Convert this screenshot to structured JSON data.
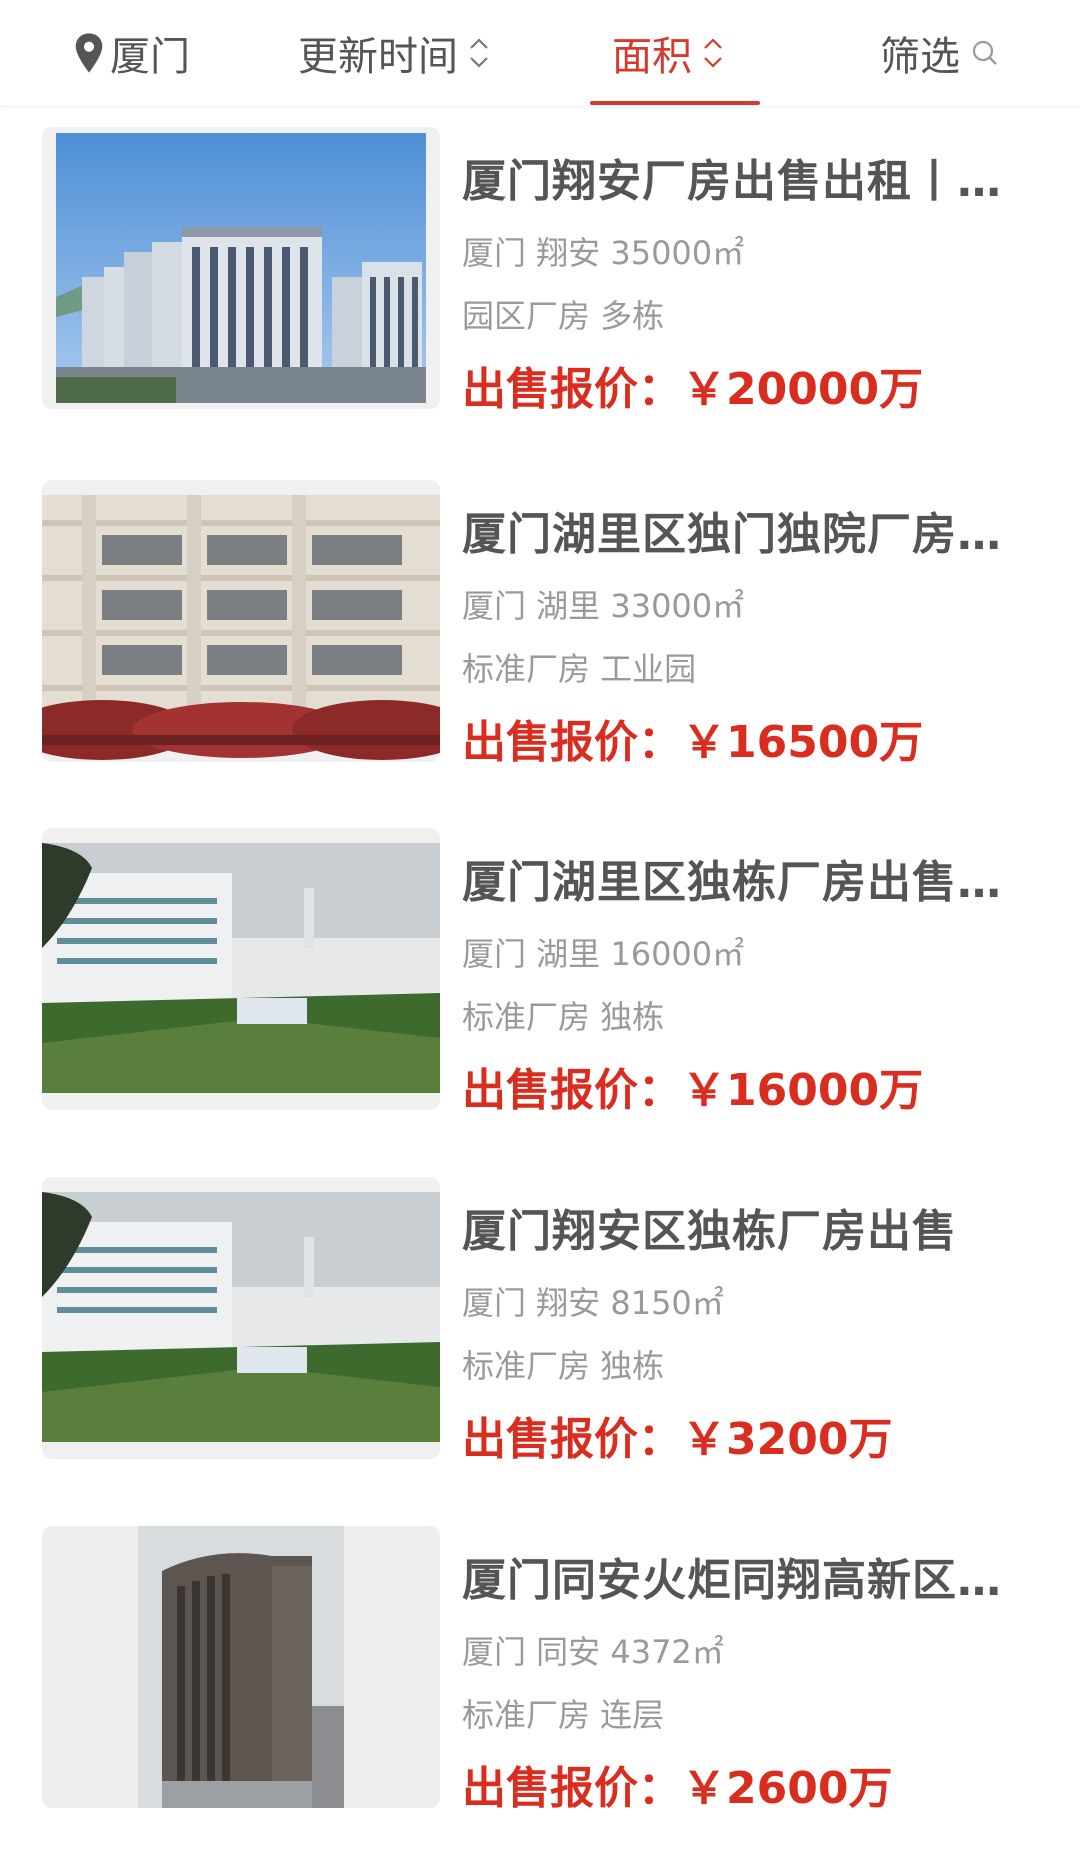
{
  "filter_bar": {
    "city": "厦门",
    "sort_time": "更新时间",
    "sort_area": "面积",
    "filter": "筛选",
    "active": "sort_area",
    "accent_color": "#d63a2c"
  },
  "listings": [
    {
      "title": "厦门翔安厂房出售出租丨…",
      "location": "厦门 翔安 35000㎡",
      "tags": "园区厂房 多栋",
      "price": "出售报价：￥20000万"
    },
    {
      "title": "厦门湖里区独门独院厂房…",
      "location": "厦门 湖里 33000㎡",
      "tags": "标准厂房 工业园",
      "price": "出售报价：￥16500万"
    },
    {
      "title": "厦门湖里区独栋厂房出售…",
      "location": "厦门 湖里 16000㎡",
      "tags": "标准厂房 独栋",
      "price": "出售报价：￥16000万"
    },
    {
      "title": "厦门翔安区独栋厂房出售",
      "location": "厦门 翔安 8150㎡",
      "tags": "标准厂房 独栋",
      "price": "出售报价：￥3200万"
    },
    {
      "title": "厦门同安火炬同翔高新区…",
      "location": "厦门 同安 4372㎡",
      "tags": "标准厂房 连层",
      "price": "出售报价：￥2600万"
    }
  ]
}
